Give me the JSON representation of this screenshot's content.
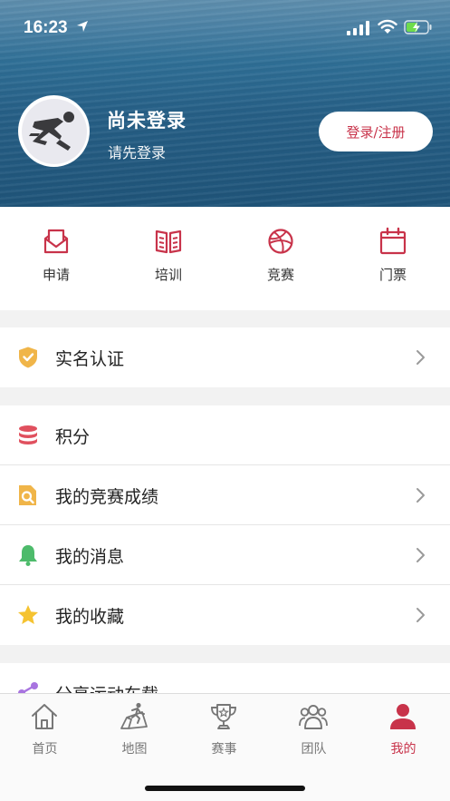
{
  "status_bar": {
    "time": "16:23"
  },
  "profile": {
    "name": "尚未登录",
    "subtitle": "请先登录",
    "login_label": "登录/注册"
  },
  "quick_actions": [
    {
      "label": "申请",
      "icon": "envelope-icon"
    },
    {
      "label": "培训",
      "icon": "book-icon"
    },
    {
      "label": "竞赛",
      "icon": "basketball-icon"
    },
    {
      "label": "门票",
      "icon": "calendar-icon"
    }
  ],
  "menu": {
    "verify": {
      "label": "实名认证",
      "icon": "shield-check-icon"
    },
    "points": {
      "label": "积分",
      "icon": "database-icon"
    },
    "results": {
      "label": "我的竞赛成绩",
      "icon": "document-search-icon"
    },
    "messages": {
      "label": "我的消息",
      "icon": "bell-icon"
    },
    "favorites": {
      "label": "我的收藏",
      "icon": "star-icon"
    },
    "share": {
      "label": "分享运动车载",
      "icon": "share-icon"
    }
  },
  "tabs": [
    {
      "label": "首页",
      "icon": "home-icon"
    },
    {
      "label": "地图",
      "icon": "map-runner-icon"
    },
    {
      "label": "赛事",
      "icon": "trophy-icon"
    },
    {
      "label": "团队",
      "icon": "group-icon"
    },
    {
      "label": "我的",
      "icon": "person-icon",
      "active": true
    }
  ],
  "colors": {
    "accent": "#c8334a",
    "sea": "#2f6f96"
  }
}
